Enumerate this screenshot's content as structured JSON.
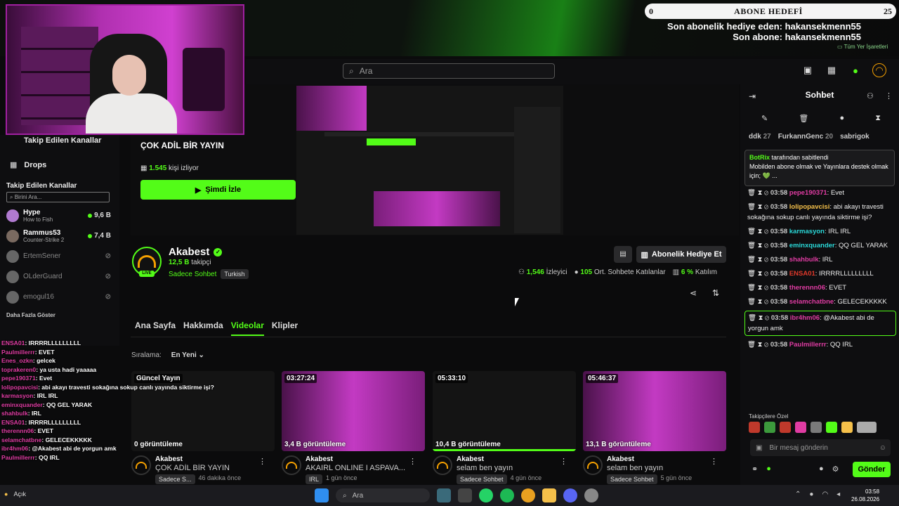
{
  "overlay": {
    "goal_left": "0",
    "goal_title": "ABONE HEDEFİ",
    "goal_right": "25",
    "last_gift": "Son abonelik hediye eden: hakansekmenn55",
    "last_sub": "Son abone: hakansekmenn55",
    "bookmarks": "Tüm Yer İşaretleri"
  },
  "header": {
    "search_placeholder": "Ara"
  },
  "sidebar": {
    "top_item": "Takip Edilen Kanallar",
    "drops": "Drops",
    "followed_title": "Takip Edilen Kanallar",
    "search_placeholder": "Birini Ara...",
    "channels": [
      {
        "name": "Hype",
        "game": "How to Fish",
        "viewers": "9,6 B"
      },
      {
        "name": "Rammus53",
        "game": "Counter-Strike 2",
        "viewers": "7,4 B"
      }
    ],
    "offline": [
      "ErtemSener",
      "OLderGuard",
      "emogul16"
    ],
    "more": "Daha Fazla Göster"
  },
  "featured": {
    "title": "ÇOK ADİL BİR YAYIN",
    "viewers_count": "1.545",
    "viewers_label": "kişi izliyor",
    "watch_button": "Şimdi İzle"
  },
  "channel": {
    "name": "Akabest",
    "live": "LIVE",
    "followers_count": "12,5 B",
    "followers_label": "takipçi",
    "category": "Sadece Sohbet",
    "language": "Turkish",
    "gift_button": "Abonelik Hediye Et",
    "stat_viewers": "1,546",
    "stat_viewers_label": "İzleyici",
    "stat_chatters": "105",
    "stat_chatters_label": "Ort. Sohbete Katılanlar",
    "stat_participation": "6 %",
    "stat_participation_label": "Katılım"
  },
  "tabs": [
    "Ana Sayfa",
    "Hakkımda",
    "Videolar",
    "Klipler"
  ],
  "sort": {
    "label": "Sıralama:",
    "value": "En Yeni"
  },
  "videos": [
    {
      "badge": "Güncel Yayın",
      "views": "0 görüntüleme",
      "author": "Akabest",
      "title": "ÇOK ADİL BİR YAYIN",
      "tag": "Sadece S...",
      "ago": "46 dakika önce"
    },
    {
      "badge": "03:27:24",
      "views": "3,4 B görüntüleme",
      "author": "Akabest",
      "title": "AKAIRL ONLINE I ASPAVA...",
      "tag": "IRL",
      "ago": "1 gün önce"
    },
    {
      "badge": "05:33:10",
      "views": "10,4 B görüntüleme",
      "author": "Akabest",
      "title": "selam ben yayın",
      "tag": "Sadece Sohbet",
      "ago": "4 gün önce"
    },
    {
      "badge": "05:46:37",
      "views": "13,1 B görüntüleme",
      "author": "Akabest",
      "title": "selam ben yayın",
      "tag": "Sadece Sohbet",
      "ago": "5 gün önce"
    }
  ],
  "chat": {
    "title": "Sohbet",
    "leaderboard": [
      {
        "name": "ddk",
        "count": "27"
      },
      {
        "name": "FurkannGenc",
        "count": "20"
      },
      {
        "name": "sabrigok",
        "count": ""
      }
    ],
    "pinned_by": "BotRix",
    "pinned_label": "tarafından sabitlendi",
    "pinned_text": "Mobilden abone olmak ve Yayınlara destek olmak için; 💚 ...",
    "messages": [
      {
        "time": "03:58",
        "user": "pepe190371",
        "color": "#e03ca3",
        "text": "Evet"
      },
      {
        "time": "03:58",
        "user": "lolipopavcisi",
        "color": "#f5c04a",
        "text": "abi akayı travesti sokağına sokup canlı yayında siktirme işi?"
      },
      {
        "time": "03:58",
        "user": "karmasyon",
        "color": "#2ad8d8",
        "text": "IRL IRL"
      },
      {
        "time": "03:58",
        "user": "eminxquander",
        "color": "#2ad8d8",
        "text": "QQ GEL YARAK"
      },
      {
        "time": "03:58",
        "user": "shahbulk",
        "color": "#e03ca3",
        "text": "IRL"
      },
      {
        "time": "03:58",
        "user": "ENSA01",
        "color": "#e0392b",
        "text": "IRRRRLLLLLLLLL"
      },
      {
        "time": "03:58",
        "user": "therennn06",
        "color": "#e03ca3",
        "text": "EVET"
      },
      {
        "time": "03:58",
        "user": "selamchatbne",
        "color": "#e03ca3",
        "text": "GELECEKKKKK"
      },
      {
        "time": "03:58",
        "user": "ibr4hm06",
        "color": "#e03ca3",
        "text": "@Akabest abi de yorgun amk"
      },
      {
        "time": "03:58",
        "user": "Paulmillerrr",
        "color": "#e03ca3",
        "text": "QQ IRL"
      }
    ],
    "emotes_label": "Takipçilere Özel",
    "input_placeholder": "Bir mesaj gönderin",
    "send": "Gönder"
  },
  "overlay_chat": [
    {
      "u": "ENSA01",
      "t": ": IRRRRLLLLLLLLL"
    },
    {
      "u": "Paulmillerrr",
      "t": ": EVET"
    },
    {
      "u": "Enes_ozkn",
      "t": ": gelcek"
    },
    {
      "u": "toprakeren0",
      "t": ": ya usta hadi yaaaaa"
    },
    {
      "u": "pepe190371",
      "t": ": Evet"
    },
    {
      "u": "lolipopavcisi",
      "t": ": abi akayı travesti sokağına sokup canlı yayında siktirme işi?"
    },
    {
      "u": "karmasyon",
      "t": ": IRL IRL"
    },
    {
      "u": "eminxquander",
      "t": ": QQ GEL YARAK"
    },
    {
      "u": "shahbulk",
      "t": ": IRL"
    },
    {
      "u": "ENSA01",
      "t": ": IRRRRLLLLLLLLL"
    },
    {
      "u": "therennn06",
      "t": ": EVET"
    },
    {
      "u": "selamchatbne",
      "t": ": GELECEKKKKK"
    },
    {
      "u": "ibr4hm06",
      "t": ": @Akabest abi de yorgun amk"
    },
    {
      "u": "Paulmillerrr",
      "t": ": QQ IRL"
    }
  ],
  "taskbar": {
    "search": "Ara",
    "time": "03:58",
    "date": "26.08.2026",
    "weather": "Açık"
  }
}
